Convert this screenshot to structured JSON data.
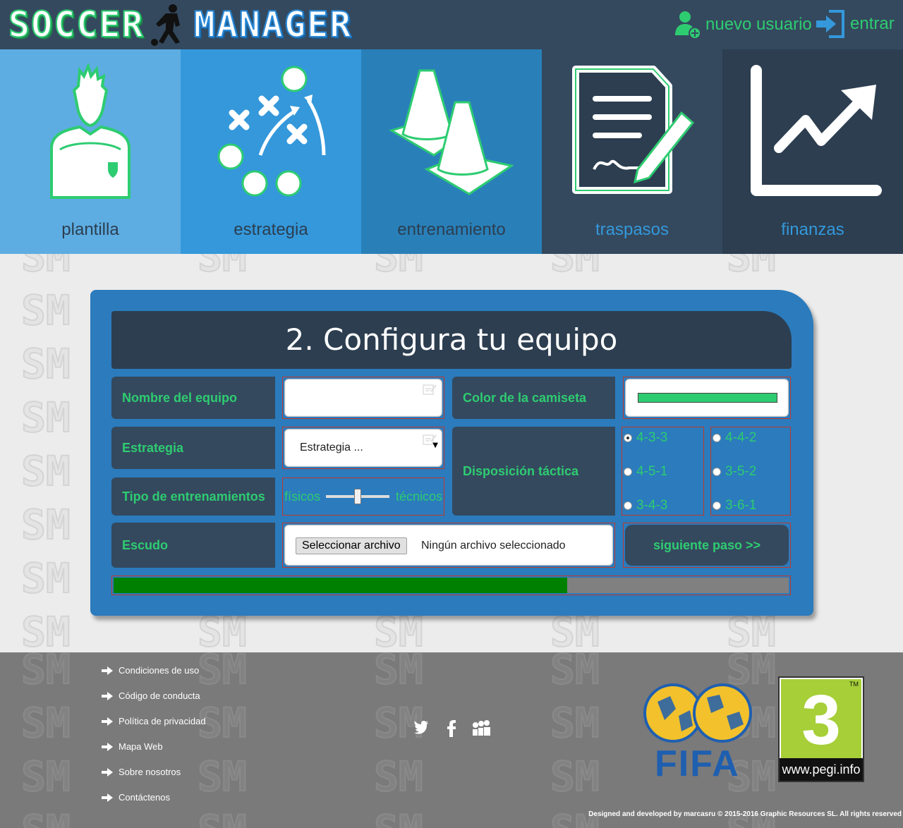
{
  "header": {
    "logo_word_1": "SOCCER",
    "logo_word_2": "MANAGER",
    "new_user_label": "nuevo usuario",
    "login_label": "entrar"
  },
  "nav": {
    "tiles": [
      {
        "label": "plantilla",
        "bg": "#5dade2",
        "label_color": "#2c3e50",
        "icon": "player-icon"
      },
      {
        "label": "estrategia",
        "bg": "#3498db",
        "label_color": "#2c3e50",
        "icon": "tactics-icon"
      },
      {
        "label": "entrenamiento",
        "bg": "#2980b9",
        "label_color": "#2c3e50",
        "icon": "cones-icon"
      },
      {
        "label": "traspasos",
        "bg": "#34495e",
        "label_color": "#3498db",
        "icon": "contract-icon"
      },
      {
        "label": "finanzas",
        "bg": "#2c3e50",
        "label_color": "#3498db",
        "icon": "chart-icon"
      }
    ]
  },
  "form": {
    "title": "2. Configura tu equipo",
    "team_name_label": "Nombre del equipo",
    "team_name_value": "",
    "shirt_color_label": "Color de la camiseta",
    "shirt_color": "#2ecc71",
    "strategy_label": "Estrategia",
    "strategy_placeholder": "Estrategia ...",
    "training_label": "Tipo de entrenamientos",
    "training_left": "físicos",
    "training_right": "técnicos",
    "training_value": 0.5,
    "tactic_label": "Disposición táctica",
    "tactics_col1": [
      "4-3-3",
      "4-5-1",
      "3-4-3"
    ],
    "tactics_col2": [
      "4-4-2",
      "3-5-2",
      "3-6-1"
    ],
    "tactic_selected": "4-3-3",
    "crest_label": "Escudo",
    "file_button": "Seleccionar archivo",
    "file_status": "Ningún archivo seleccionado",
    "next_button": "siguiente paso >>",
    "progress": 0.67
  },
  "footer": {
    "links": [
      "Condiciones de uso",
      "Código de conducta",
      "Política de privacidad",
      "Mapa Web",
      "Sobre nosotros",
      "Contáctenos"
    ],
    "social": [
      "twitter-icon",
      "facebook-icon",
      "myspace-icon"
    ],
    "fifa_text": "FIFA",
    "pegi_rating": "3",
    "pegi_tm": "TM",
    "pegi_url": "www.pegi.info",
    "copyright": "Designed and developed by marcasru © 2015-2016 Graphic Resources SL. All rights reserved"
  },
  "colors": {
    "accent_green": "#2ecc71",
    "accent_blue": "#3498db",
    "dark": "#34495e"
  }
}
